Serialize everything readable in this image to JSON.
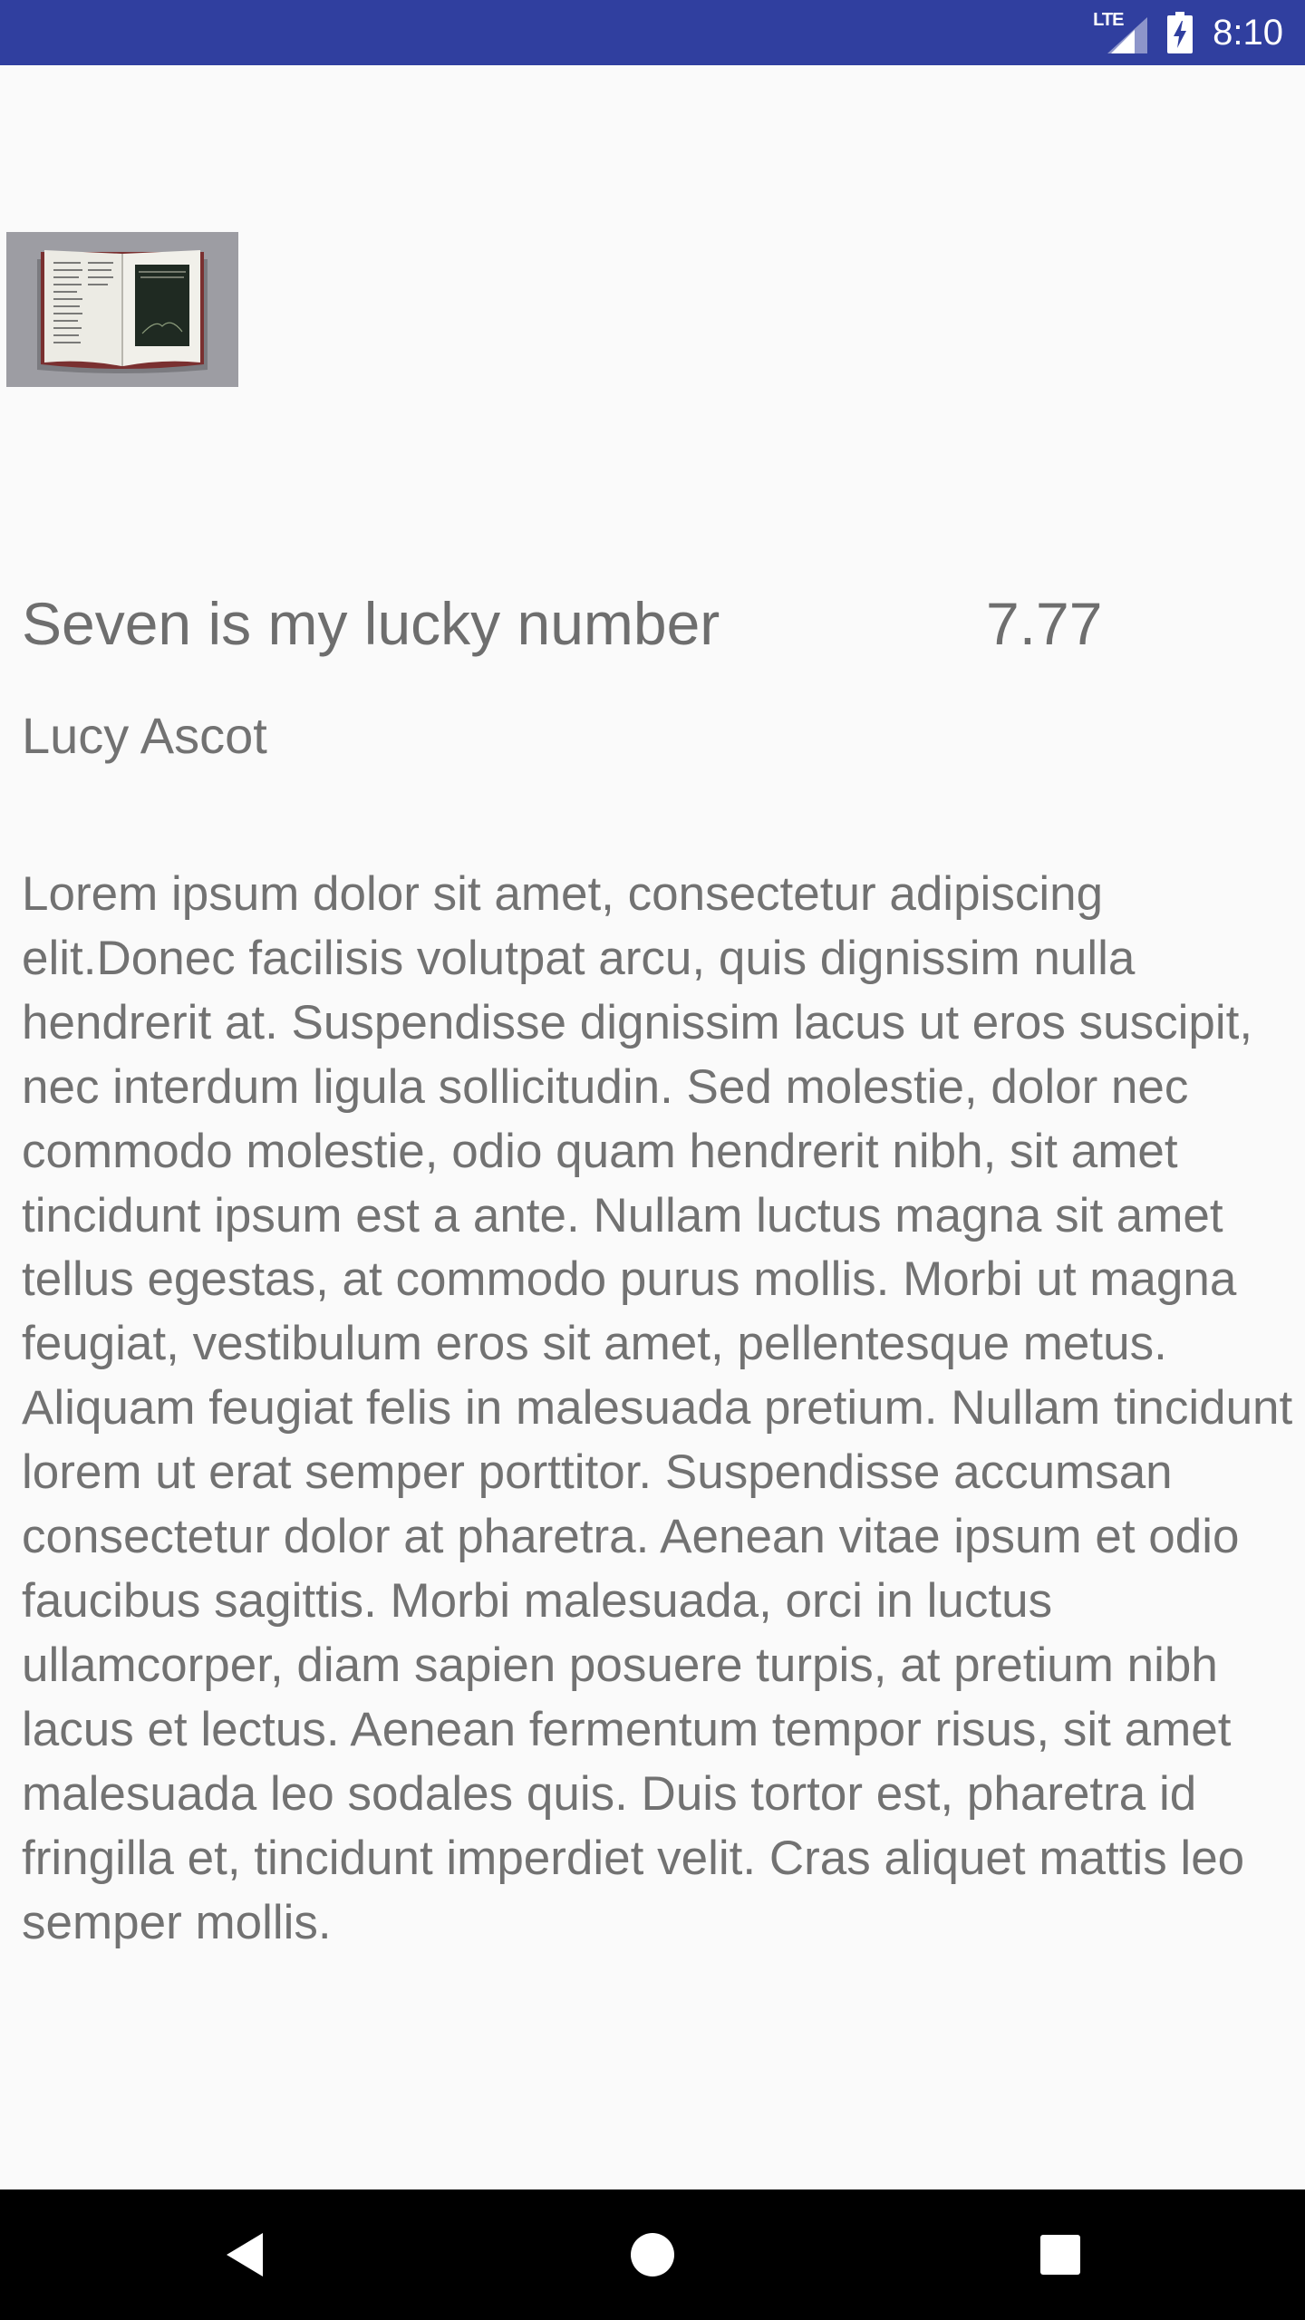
{
  "status_bar": {
    "network_label": "LTE",
    "time": "8:10",
    "background_color": "#303f9f",
    "icons": [
      "lte-signal-icon",
      "battery-charging-icon"
    ]
  },
  "book": {
    "image_name": "open-book-thumbnail",
    "title": "Seven is my lucky number",
    "price": "7.77",
    "author": "Lucy Ascot",
    "description": "Lorem ipsum dolor sit amet, consectetur adipiscing elit.Donec facilisis volutpat arcu, quis dignissim nulla hendrerit at. Suspendisse dignissim lacus ut eros suscipit, nec interdum ligula sollicitudin. Sed molestie, dolor nec commodo molestie, odio quam hendrerit nibh, sit amet tincidunt ipsum est a ante. Nullam luctus magna sit amet tellus egestas, at commodo purus mollis. Morbi ut magna feugiat, vestibulum eros sit amet, pellentesque metus. Aliquam feugiat felis in malesuada pretium. Nullam tincidunt lorem ut erat semper porttitor. Suspendisse accumsan consectetur dolor at pharetra. Aenean vitae ipsum et odio faucibus sagittis. Morbi malesuada, orci in luctus ullamcorper, diam sapien posuere turpis, at pretium nibh lacus et lectus. Aenean fermentum tempor risus, sit amet malesuada leo sodales quis. Duis tortor est, pharetra id fringilla et, tincidunt imperdiet velit. Cras aliquet mattis leo semper mollis."
  },
  "nav_bar": {
    "buttons": [
      "back-icon",
      "home-icon",
      "recents-icon"
    ],
    "background_color": "#000000"
  }
}
